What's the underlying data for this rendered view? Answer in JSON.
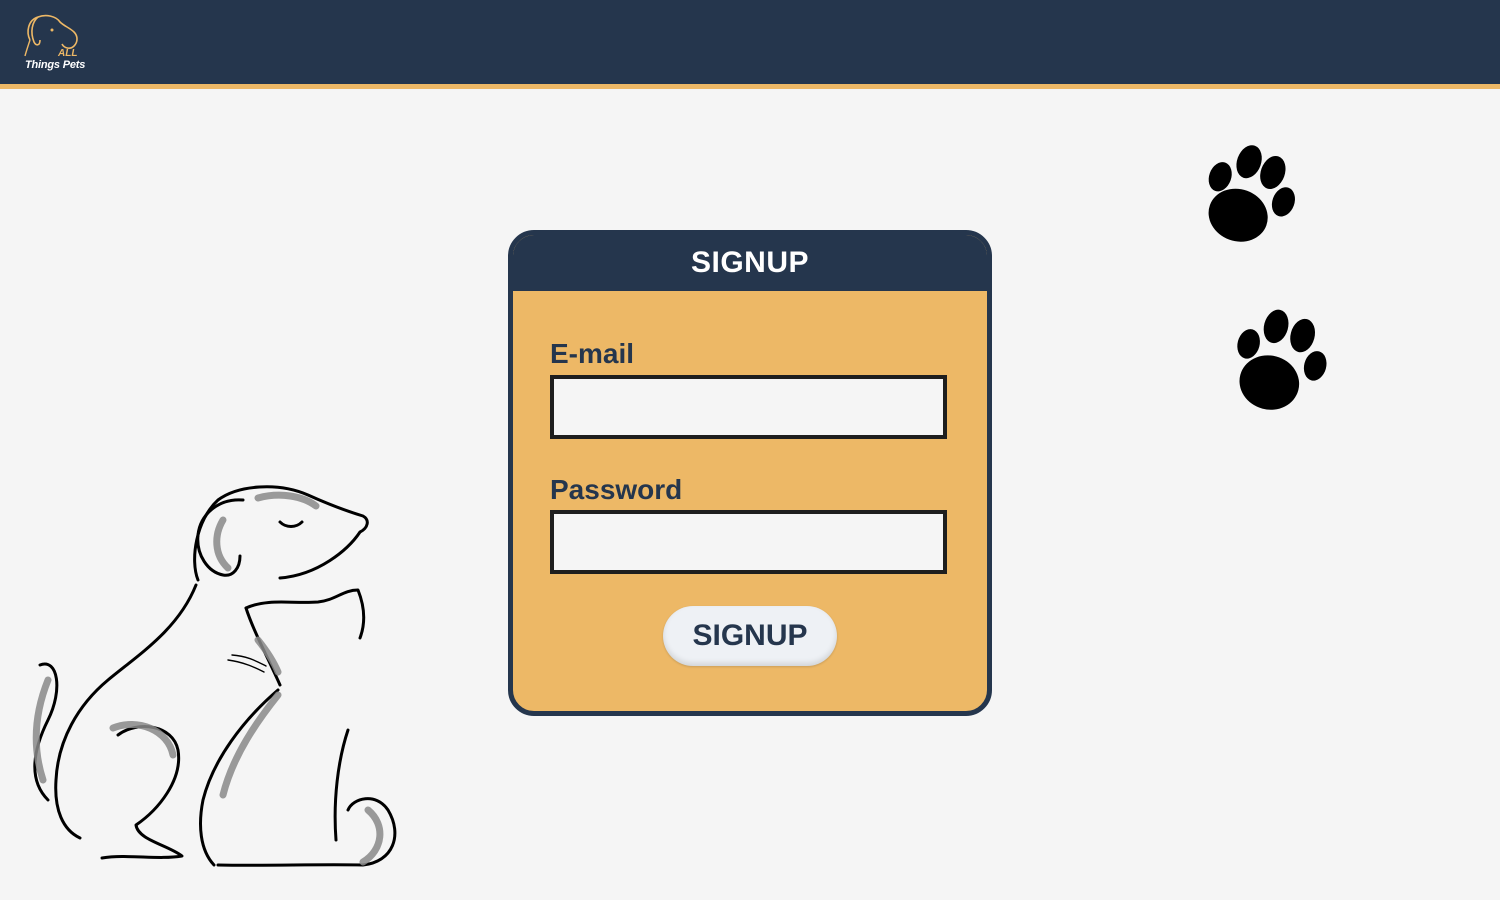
{
  "header": {
    "logo_text": "Things Pets",
    "logo_accent": "ALL"
  },
  "signup_form": {
    "title": "SIGNUP",
    "email_label": "E-mail",
    "email_value": "",
    "email_placeholder": "",
    "password_label": "Password",
    "password_value": "",
    "password_placeholder": "",
    "submit_label": "SIGNUP"
  },
  "colors": {
    "navy": "#25364d",
    "accent": "#edb866",
    "background": "#f5f5f5"
  }
}
